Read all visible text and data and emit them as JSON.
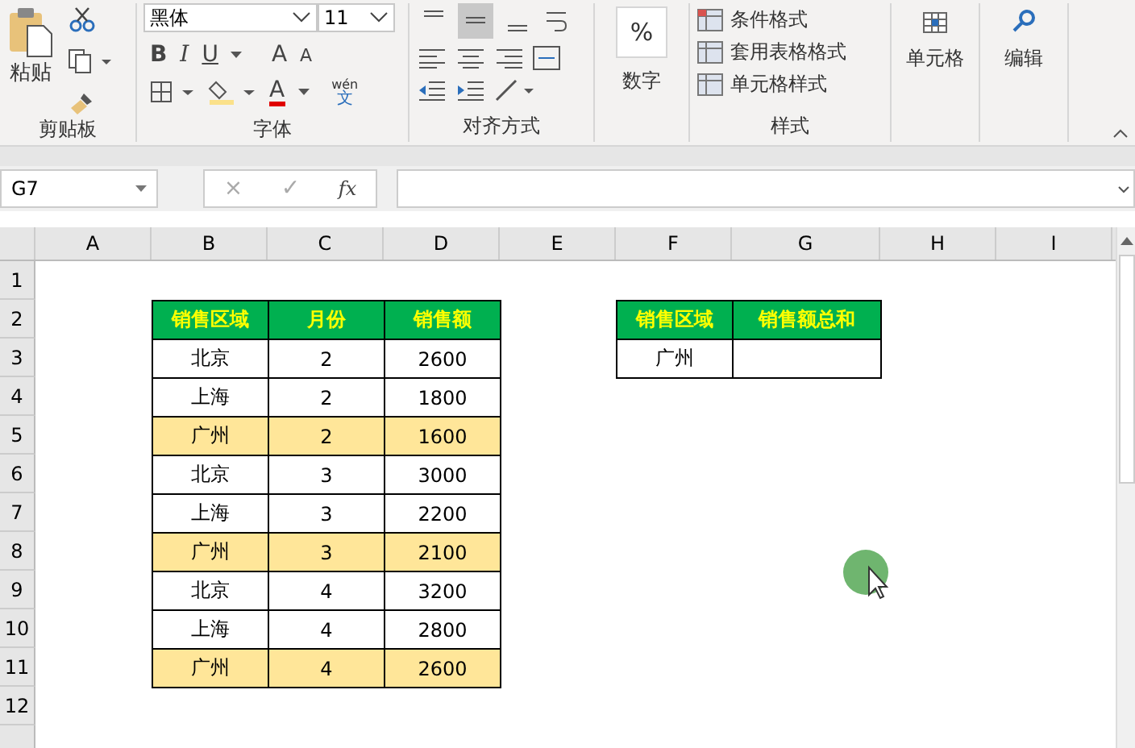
{
  "ribbon": {
    "clipboard": {
      "paste": "粘贴",
      "label": "剪贴板"
    },
    "font": {
      "name": "黑体",
      "size": "11",
      "bold": "B",
      "italic": "I",
      "underline": "U",
      "grow": "A",
      "shrink": "A",
      "font_color": "A",
      "phonetic_top": "wén",
      "phonetic_bottom": "文",
      "label": "字体"
    },
    "alignment": {
      "vertical": [
        {
          "kind": "top",
          "selected": false
        },
        {
          "kind": "middle",
          "selected": true
        },
        {
          "kind": "bottom",
          "selected": false
        }
      ],
      "label": "对齐方式"
    },
    "number": {
      "symbol": "%",
      "label": "数字"
    },
    "styles": {
      "items": [
        "条件格式",
        "套用表格格式",
        "单元格样式"
      ],
      "label": "样式"
    },
    "cells": {
      "label": "单元格"
    },
    "editing": {
      "label": "编辑"
    }
  },
  "formula_bar": {
    "name_box": "G7",
    "cancel": "×",
    "enter": "✓",
    "fx": "fx"
  },
  "sheet": {
    "columns": [
      "A",
      "B",
      "C",
      "D",
      "E",
      "F",
      "G",
      "H",
      "I"
    ],
    "row_numbers": [
      "1",
      "2",
      "3",
      "4",
      "5",
      "6",
      "7",
      "8",
      "9",
      "10",
      "11",
      "12"
    ],
    "sales_table": {
      "header": [
        "销售区域",
        "月份",
        "销售额"
      ],
      "rows": [
        {
          "region": "北京",
          "month": "2",
          "amount": "2600",
          "highlighted": false
        },
        {
          "region": "上海",
          "month": "2",
          "amount": "1800",
          "highlighted": false
        },
        {
          "region": "广州",
          "month": "2",
          "amount": "1600",
          "highlighted": true
        },
        {
          "region": "北京",
          "month": "3",
          "amount": "3000",
          "highlighted": false
        },
        {
          "region": "上海",
          "month": "3",
          "amount": "2200",
          "highlighted": false
        },
        {
          "region": "广州",
          "month": "3",
          "amount": "2100",
          "highlighted": true
        },
        {
          "region": "北京",
          "month": "4",
          "amount": "3200",
          "highlighted": false
        },
        {
          "region": "上海",
          "month": "4",
          "amount": "2800",
          "highlighted": false
        },
        {
          "region": "广州",
          "month": "4",
          "amount": "2600",
          "highlighted": true
        }
      ]
    },
    "summary_table": {
      "header": [
        "销售区域",
        "销售额总和"
      ],
      "rows": [
        {
          "region": "广州",
          "total": ""
        }
      ]
    }
  }
}
